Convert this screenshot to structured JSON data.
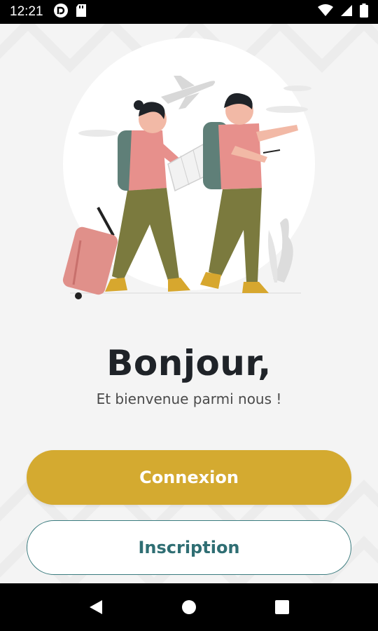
{
  "status_bar": {
    "time": "12:21",
    "left_icons": [
      "pocket-casts-icon",
      "sd-card-icon"
    ],
    "right_icons": [
      "wifi-icon",
      "signal-icon",
      "battery-icon"
    ]
  },
  "welcome": {
    "title": "Bonjour,",
    "subtitle": "Et bienvenue parmi nous !"
  },
  "actions": {
    "login_label": "Connexion",
    "signup_label": "Inscription"
  },
  "nav_bar": {
    "items": [
      "back-icon",
      "home-icon",
      "recents-icon"
    ]
  },
  "colors": {
    "primary": "#d4aa30",
    "secondary_text": "#2f6e73",
    "background": "#f4f4f4",
    "title": "#1f2328"
  }
}
